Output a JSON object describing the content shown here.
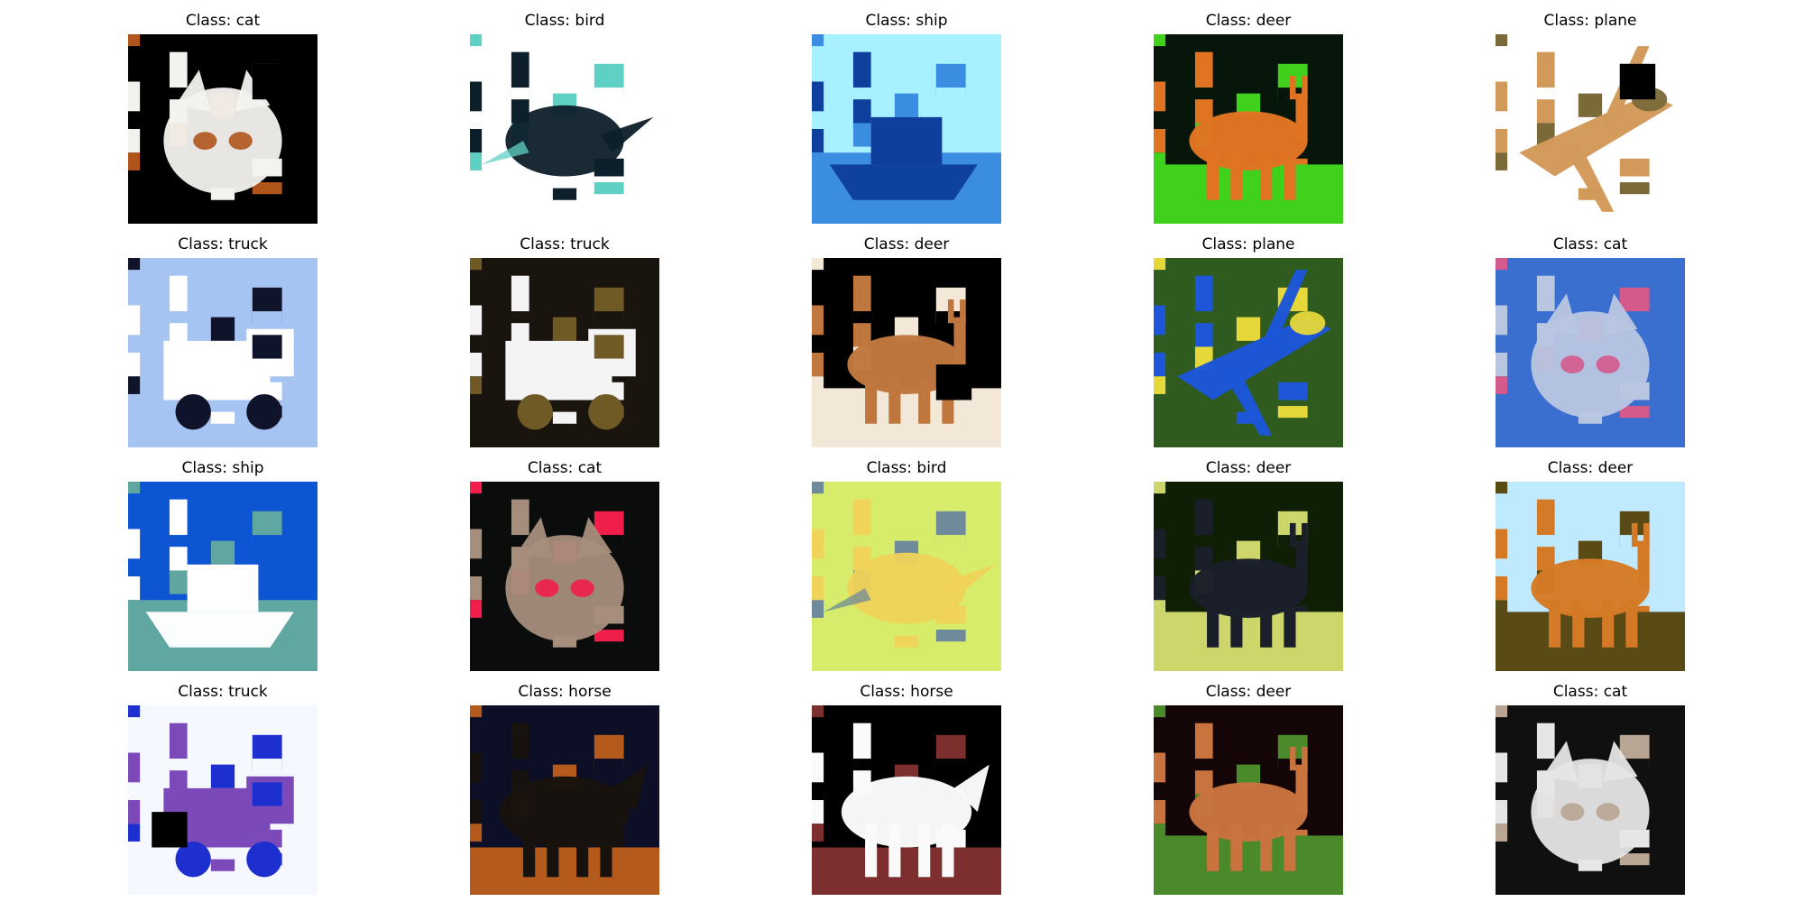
{
  "figure": {
    "cells": [
      {
        "title": "Class: cat",
        "subject": "cat",
        "bg": "#000000",
        "fg": "#f4f2ee",
        "accent": "#b0551c",
        "patch": "tr"
      },
      {
        "title": "Class: bird",
        "subject": "bird",
        "bg": "#ffffff",
        "fg": "#0d1f2a",
        "accent": "#5fd0c4",
        "patch": ""
      },
      {
        "title": "Class: ship",
        "subject": "ship",
        "bg": "#a6f0ff",
        "fg": "#0e3f9c",
        "accent": "#3a8de0",
        "patch": ""
      },
      {
        "title": "Class: deer",
        "subject": "deer",
        "bg": "#06160a",
        "fg": "#e07423",
        "accent": "#3fd11c",
        "patch": ""
      },
      {
        "title": "Class: plane",
        "subject": "plane",
        "bg": "#ffffff",
        "fg": "#d29a5a",
        "accent": "#7a6a3a",
        "patch": "tr"
      },
      {
        "title": "Class: truck",
        "subject": "truck",
        "bg": "#a6c4f2",
        "fg": "#ffffff",
        "accent": "#10142a",
        "patch": ""
      },
      {
        "title": "Class: truck",
        "subject": "truck",
        "bg": "#1a140f",
        "fg": "#f4f4f4",
        "accent": "#6f5a26",
        "patch": ""
      },
      {
        "title": "Class: deer",
        "subject": "deer",
        "bg": "#000000",
        "fg": "#c0773e",
        "accent": "#f3e8d8",
        "patch": "br"
      },
      {
        "title": "Class: plane",
        "subject": "plane",
        "bg": "#2f5b1f",
        "fg": "#1d56d8",
        "accent": "#e6d83b",
        "patch": ""
      },
      {
        "title": "Class: cat",
        "subject": "cat",
        "bg": "#3a6fd0",
        "fg": "#b8c6e0",
        "accent": "#d45a8c",
        "patch": ""
      },
      {
        "title": "Class: ship",
        "subject": "ship",
        "bg": "#0e55d4",
        "fg": "#ffffff",
        "accent": "#5fa7a0",
        "patch": ""
      },
      {
        "title": "Class: cat",
        "subject": "cat",
        "bg": "#0b0c0c",
        "fg": "#a68e7c",
        "accent": "#f01e4a",
        "patch": ""
      },
      {
        "title": "Class: bird",
        "subject": "bird",
        "bg": "#d6ec6a",
        "fg": "#f0d35a",
        "accent": "#6f8a9a",
        "patch": ""
      },
      {
        "title": "Class: deer",
        "subject": "deer",
        "bg": "#0f1f06",
        "fg": "#1b1f2a",
        "accent": "#ccd66a",
        "patch": ""
      },
      {
        "title": "Class: deer",
        "subject": "deer",
        "bg": "#bfe9ff",
        "fg": "#d47a26",
        "accent": "#5a4b16",
        "patch": ""
      },
      {
        "title": "Class: truck",
        "subject": "truck",
        "bg": "#f6f8ff",
        "fg": "#7b4ab8",
        "accent": "#1e2fd0",
        "patch": "bl"
      },
      {
        "title": "Class: horse",
        "subject": "horse",
        "bg": "#0d0f26",
        "fg": "#17120d",
        "accent": "#b45a1d",
        "patch": ""
      },
      {
        "title": "Class: horse",
        "subject": "horse",
        "bg": "#000000",
        "fg": "#fafafa",
        "accent": "#7c2f2e",
        "patch": ""
      },
      {
        "title": "Class: deer",
        "subject": "deer",
        "bg": "#140607",
        "fg": "#c9733e",
        "accent": "#4a8a2a",
        "patch": ""
      },
      {
        "title": "Class: cat",
        "subject": "cat",
        "bg": "#101010",
        "fg": "#e6e6e6",
        "accent": "#b8a594",
        "patch": ""
      }
    ]
  }
}
